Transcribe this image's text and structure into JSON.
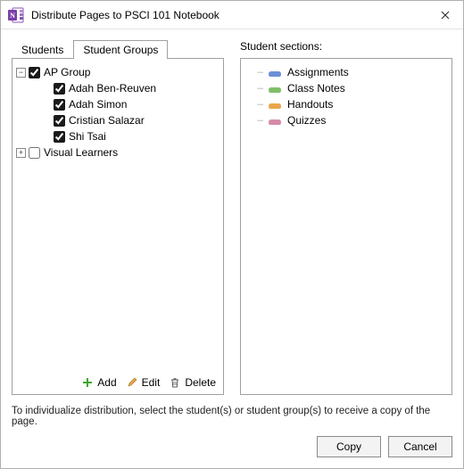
{
  "window": {
    "title": "Distribute Pages to PSCI 101 Notebook"
  },
  "tabs": {
    "students": "Students",
    "student_groups": "Student Groups",
    "active": "student_groups"
  },
  "tree": {
    "groups": [
      {
        "name": "AP Group",
        "expanded": true,
        "checked": true,
        "members": [
          {
            "name": "Adah Ben-Reuven",
            "checked": true
          },
          {
            "name": "Adah Simon",
            "checked": true
          },
          {
            "name": "Cristian Salazar",
            "checked": true
          },
          {
            "name": "Shi Tsai",
            "checked": true
          }
        ]
      },
      {
        "name": "Visual Learners",
        "expanded": false,
        "checked": false,
        "members": []
      }
    ]
  },
  "tree_actions": {
    "add": "Add",
    "edit": "Edit",
    "delete": "Delete"
  },
  "sections": {
    "label": "Student sections:",
    "items": [
      {
        "name": "Assignments",
        "color": "#6b8fd6"
      },
      {
        "name": "Class Notes",
        "color": "#7fbf6a"
      },
      {
        "name": "Handouts",
        "color": "#e8a54b"
      },
      {
        "name": "Quizzes",
        "color": "#d68aa8"
      }
    ]
  },
  "hint": "To individualize distribution, select the student(s) or student group(s) to receive a copy of the page.",
  "buttons": {
    "copy": "Copy",
    "cancel": "Cancel"
  }
}
